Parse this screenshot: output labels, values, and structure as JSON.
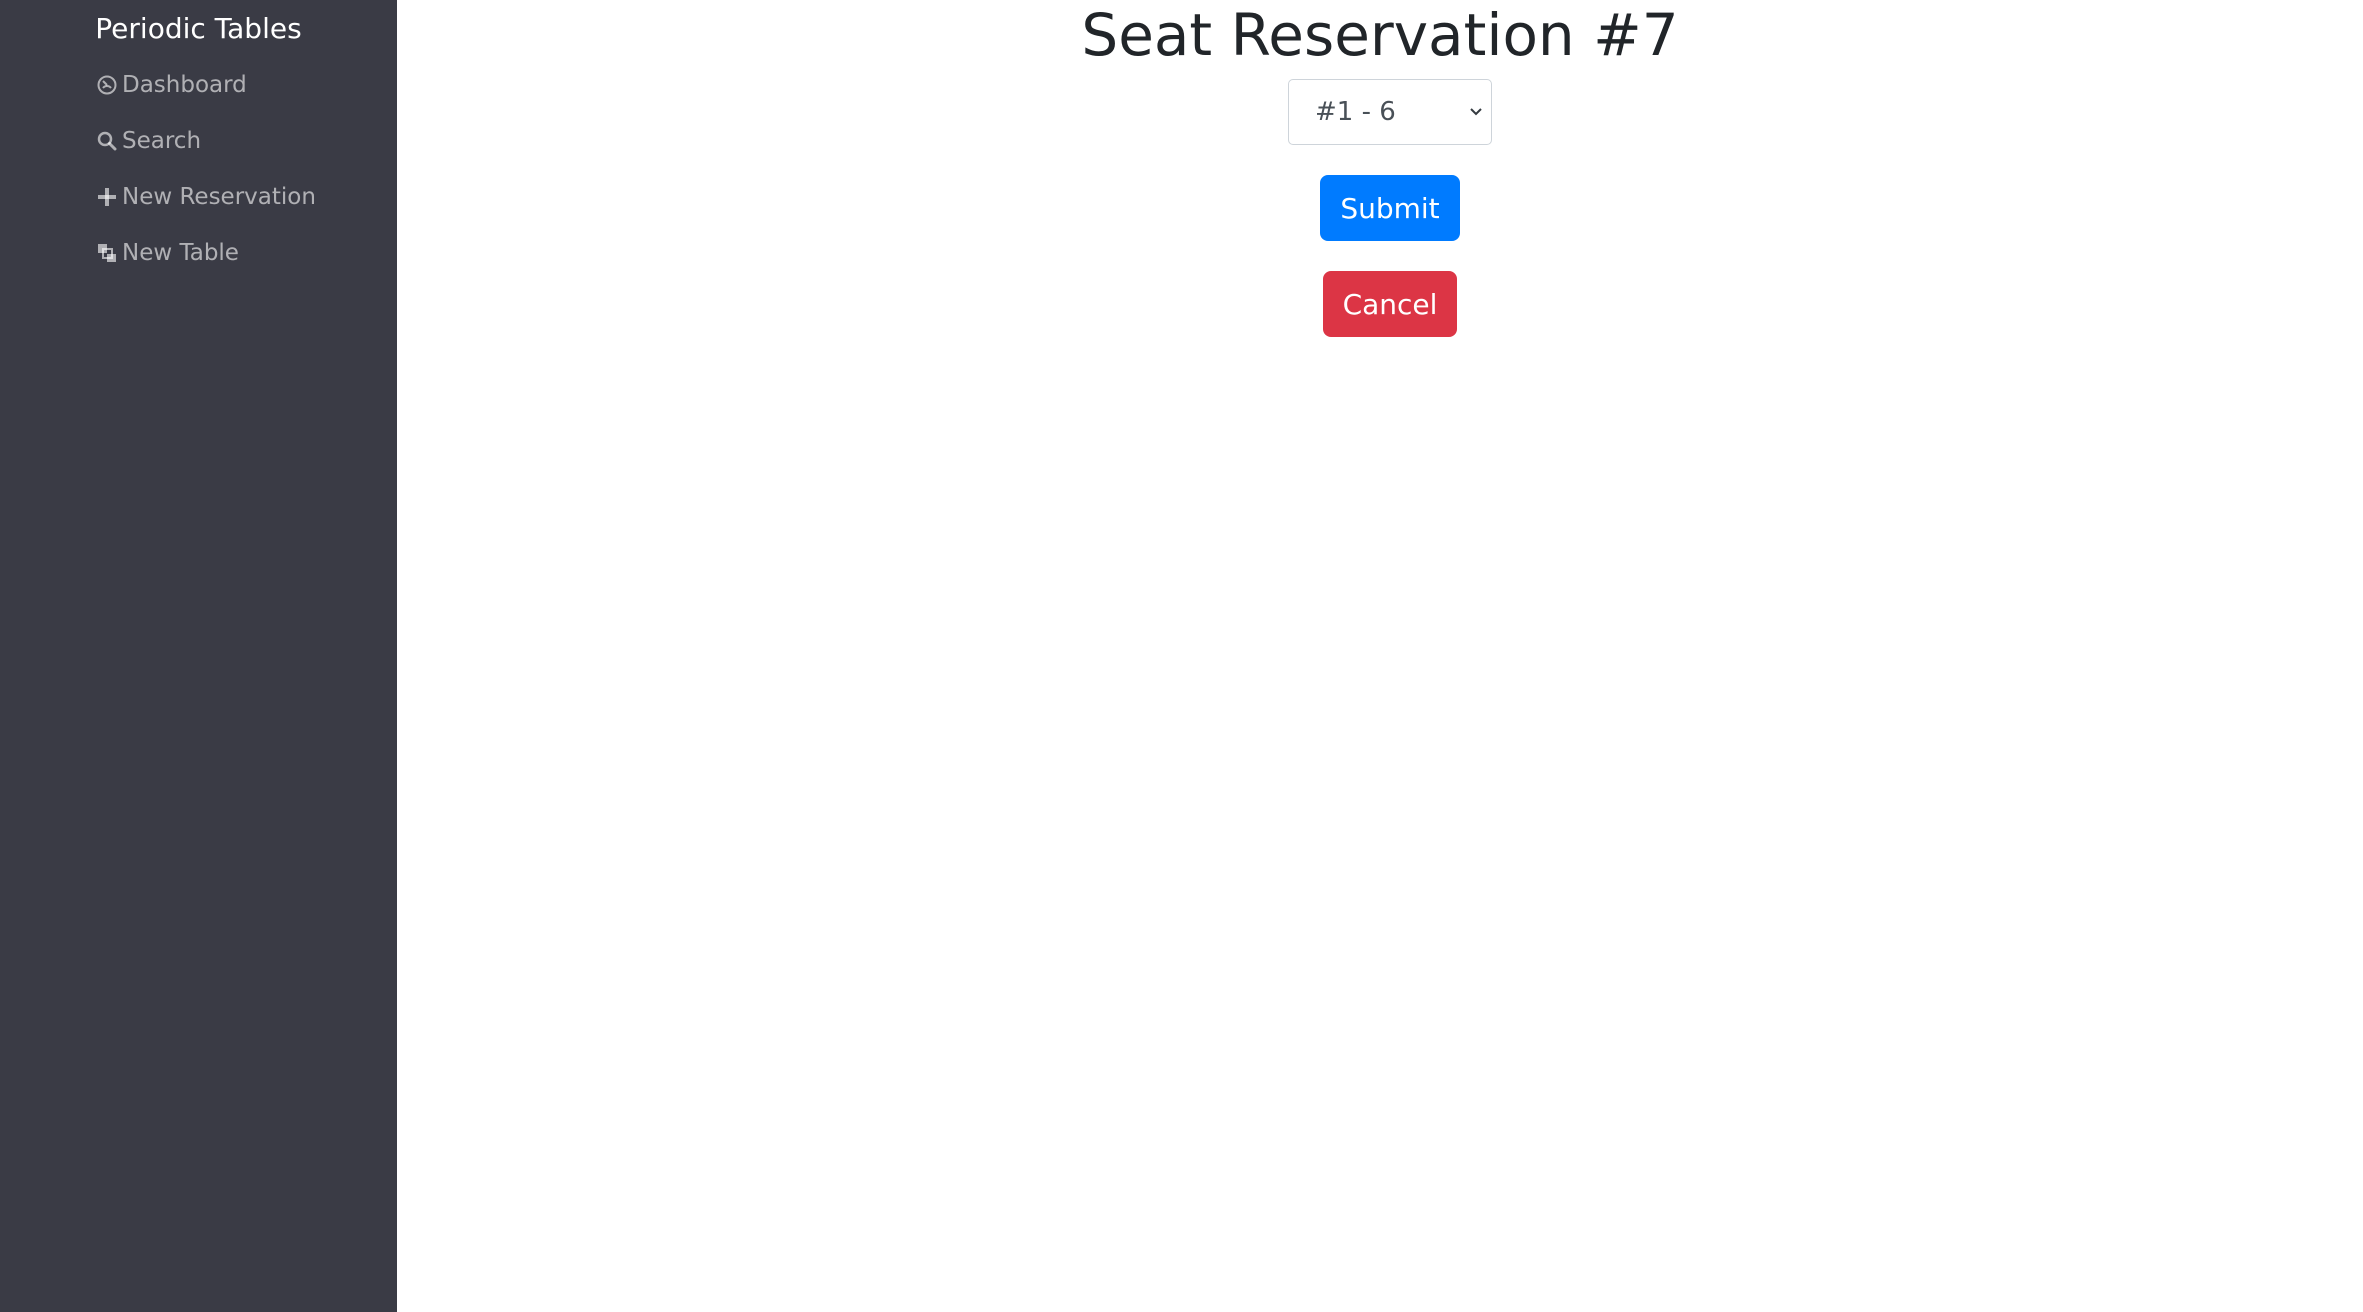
{
  "app": {
    "brand": "Periodic Tables"
  },
  "sidebar": {
    "items": [
      {
        "label": "Dashboard",
        "icon": "dashboard-gauge-icon"
      },
      {
        "label": "Search",
        "icon": "search-icon"
      },
      {
        "label": "New Reservation",
        "icon": "plus-icon"
      },
      {
        "label": "New Table",
        "icon": "layers-icon"
      }
    ]
  },
  "main": {
    "title": "Seat Reservation #7",
    "table_select": {
      "selected": "#1 - 6"
    },
    "submit_label": "Submit",
    "cancel_label": "Cancel"
  },
  "colors": {
    "sidebar_bg": "#3a3b45",
    "primary": "#007bff",
    "danger": "#dc3545"
  }
}
